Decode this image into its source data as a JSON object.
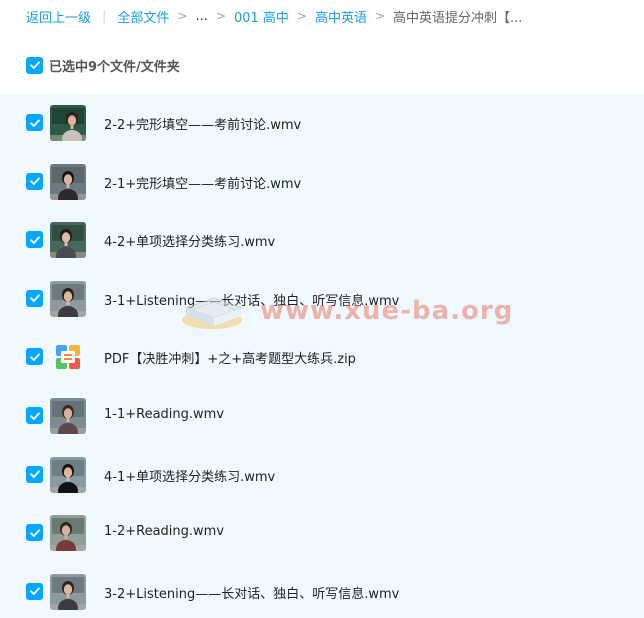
{
  "breadcrumb": {
    "back": "返回上一级",
    "divider": "|",
    "all_files": "全部文件",
    "ellipsis": "...",
    "level1": "001 高中",
    "level2": "高中英语",
    "current": "高中英语提分冲刺【...",
    "sep": ">"
  },
  "selection": {
    "summary": "已选中9个文件/文件夹"
  },
  "files": [
    {
      "name": "2-2+完形填空——考前讨论.wmv",
      "type": "video",
      "thumb": "teacher-blackboard-man"
    },
    {
      "name": "2-1+完形填空——考前讨论.wmv",
      "type": "video",
      "thumb": "teacher-woman-dark"
    },
    {
      "name": "4-2+单项选择分类练习.wmv",
      "type": "video",
      "thumb": "teacher-woman-board"
    },
    {
      "name": "3-1+Listening——长对话、独白、听写信息.wmv",
      "type": "video",
      "thumb": "teacher-woman-room"
    },
    {
      "name": "PDF【决胜冲刺】+之+高考题型大练兵.zip",
      "type": "zip",
      "thumb": "zip-icon"
    },
    {
      "name": "1-1+Reading.wmv",
      "type": "video",
      "thumb": "teacher-woman-short-hair"
    },
    {
      "name": "4-1+单项选择分类练习.wmv",
      "type": "video",
      "thumb": "teacher-woman-black"
    },
    {
      "name": "1-2+Reading.wmv",
      "type": "video",
      "thumb": "teacher-woman-desk"
    },
    {
      "name": "3-2+Listening——长对话、独白、听写信息.wmv",
      "type": "video",
      "thumb": "teacher-woman-room"
    }
  ],
  "watermark": {
    "text": "www.xue-ba.org"
  },
  "colors": {
    "accent": "#06a7ff",
    "link": "#1a9ce8",
    "list_background": "#f0f9ff",
    "watermark": "#e87a6a"
  }
}
